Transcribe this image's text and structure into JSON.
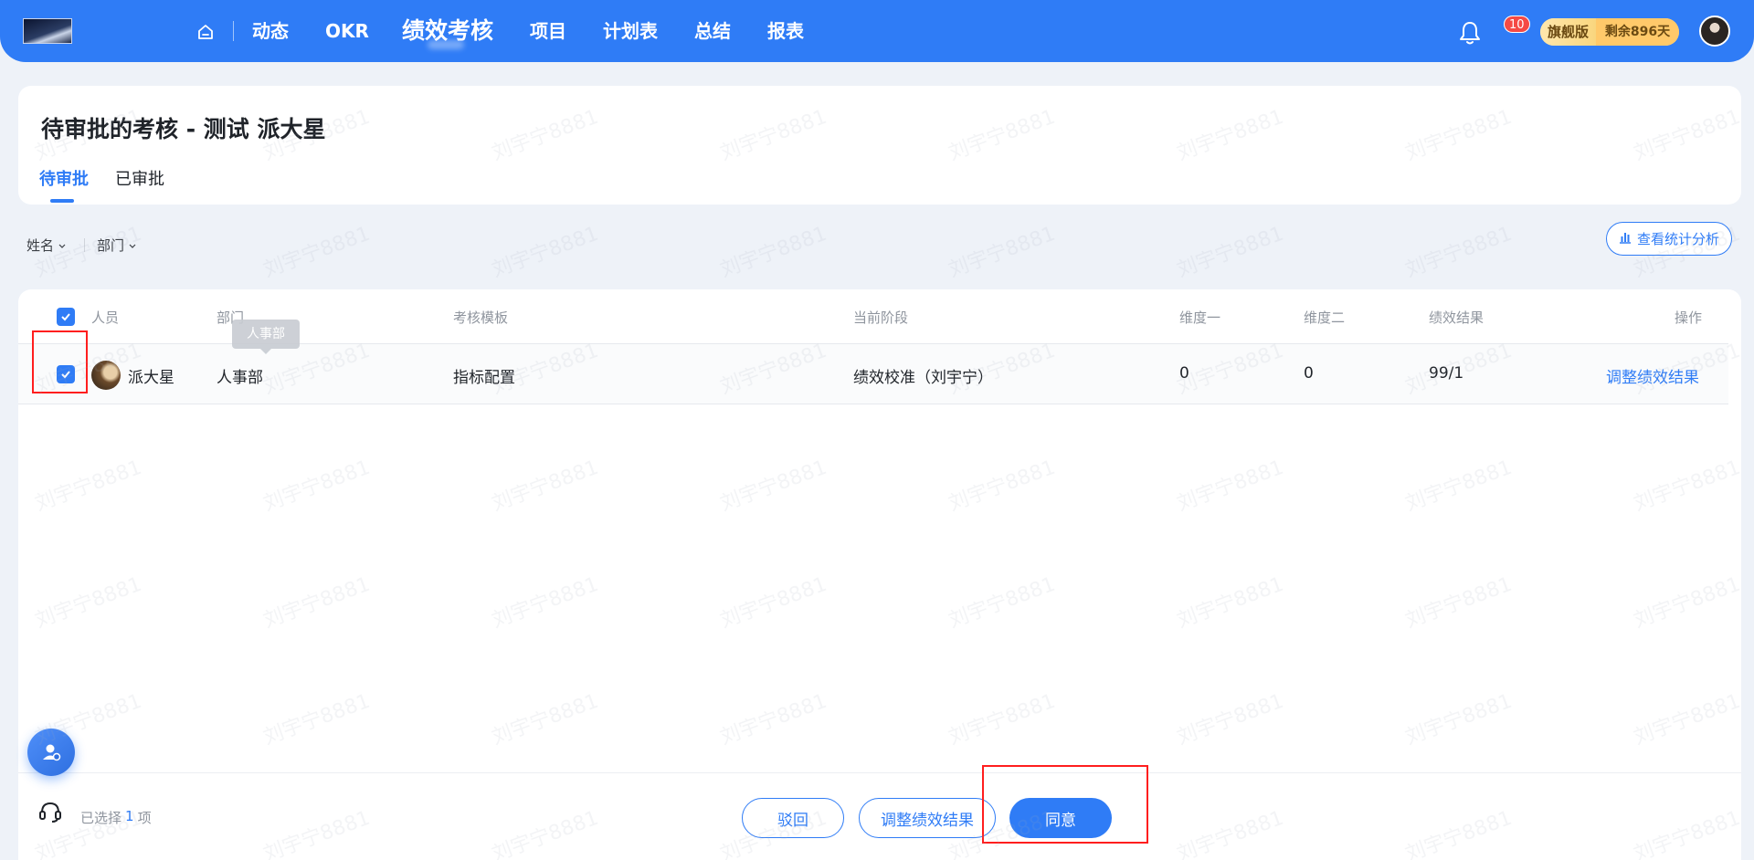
{
  "nav": {
    "home_icon": "home-icon",
    "items": [
      {
        "label": "动态"
      },
      {
        "label": "OKR"
      },
      {
        "label": "绩效考核"
      },
      {
        "label": "项目"
      },
      {
        "label": "计划表"
      },
      {
        "label": "总结"
      },
      {
        "label": "报表"
      }
    ],
    "active_index": 2,
    "notifications": "10",
    "plan_label": "旗舰版",
    "plan_remaining": "剩余896天"
  },
  "page": {
    "title": "待审批的考核 - 测试 派大星",
    "tabs": [
      {
        "label": "待审批"
      },
      {
        "label": "已审批"
      }
    ],
    "active_tab": 0
  },
  "filters": {
    "name_label": "姓名",
    "dept_label": "部门",
    "stats_button": "查看统计分析"
  },
  "table": {
    "columns": [
      "人员",
      "部门",
      "考核模板",
      "当前阶段",
      "维度一",
      "维度二",
      "绩效结果",
      "操作"
    ],
    "rows": [
      {
        "person": "派大星",
        "dept": "人事部",
        "template": "指标配置",
        "stage": "绩效校准（刘宇宁）",
        "dim1": "0",
        "dim2": "0",
        "result": "99/1",
        "action": "调整绩效结果"
      }
    ],
    "tooltip": "人事部"
  },
  "footer": {
    "selected_prefix": "已选择",
    "selected_count": "1",
    "selected_suffix": "项",
    "reject_label": "驳回",
    "adjust_label": "调整绩效结果",
    "approve_label": "同意"
  },
  "watermark": "刘宇宁8881",
  "colors": {
    "primary": "#2f7cf6",
    "annotation": "#ff1e1e",
    "badge": "#f54a45"
  }
}
